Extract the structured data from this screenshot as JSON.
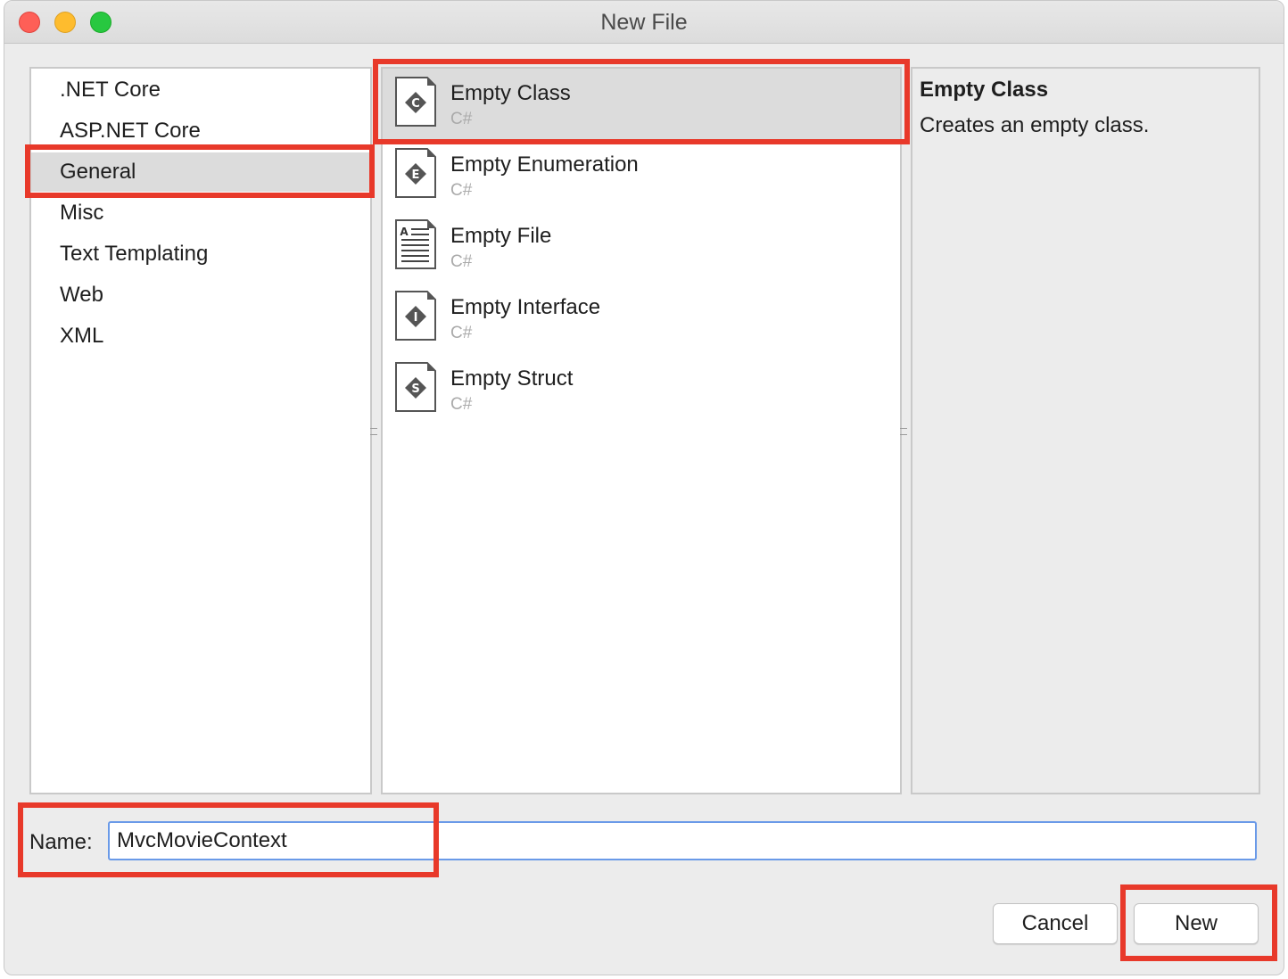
{
  "window": {
    "title": "New File"
  },
  "categories": [
    {
      "label": ".NET Core",
      "selected": false
    },
    {
      "label": "ASP.NET Core",
      "selected": false
    },
    {
      "label": "General",
      "selected": true
    },
    {
      "label": "Misc",
      "selected": false
    },
    {
      "label": "Text Templating",
      "selected": false
    },
    {
      "label": "Web",
      "selected": false
    },
    {
      "label": "XML",
      "selected": false
    }
  ],
  "templates": [
    {
      "name": "Empty Class",
      "language": "C#",
      "icon": "class-file-icon",
      "glyph": "C",
      "selected": true
    },
    {
      "name": "Empty Enumeration",
      "language": "C#",
      "icon": "enum-file-icon",
      "glyph": "E",
      "selected": false
    },
    {
      "name": "Empty File",
      "language": "C#",
      "icon": "text-file-icon",
      "glyph": "A",
      "selected": false
    },
    {
      "name": "Empty Interface",
      "language": "C#",
      "icon": "interface-file-icon",
      "glyph": "I",
      "selected": false
    },
    {
      "name": "Empty Struct",
      "language": "C#",
      "icon": "struct-file-icon",
      "glyph": "S",
      "selected": false
    }
  ],
  "description": {
    "title": "Empty Class",
    "text": "Creates an empty class."
  },
  "name_field": {
    "label": "Name:",
    "value": "MvcMovieContext"
  },
  "buttons": {
    "cancel": "Cancel",
    "new": "New"
  },
  "colors": {
    "highlight": "#e8392a",
    "selection": "#dcdcdc",
    "input_focus": "#6a9ae8"
  }
}
